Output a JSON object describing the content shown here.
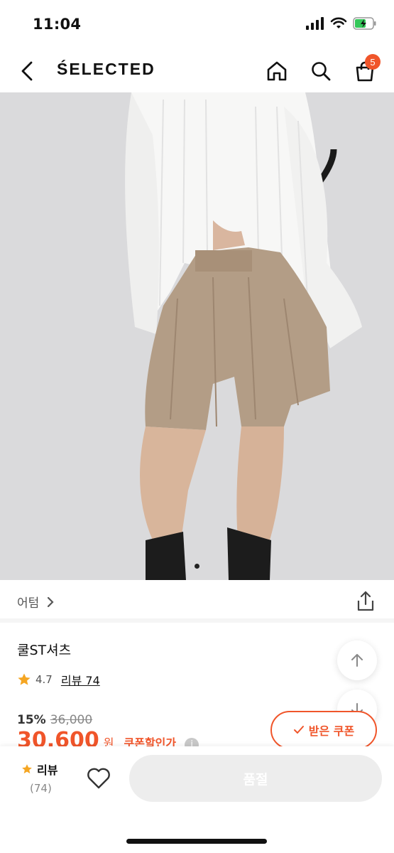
{
  "status_bar": {
    "time": "11:04"
  },
  "nav": {
    "brand": "ŚELECTED",
    "cart_count": "5"
  },
  "product": {
    "category": "어텀",
    "name": "쿨ST셔츠",
    "rating": "4.7",
    "review_label": "리뷰 74",
    "discount": "15%",
    "original_price": "36,000",
    "sale_price": "30,600",
    "currency": "원",
    "coupon_label": "쿠폰할인가",
    "coupon_button": "받은 쿠폰"
  },
  "bottom_bar": {
    "review_label": "리뷰",
    "review_count": "(74)",
    "buy_button": "품절"
  },
  "colors": {
    "accent": "#f0552a",
    "star": "#f5a623"
  }
}
